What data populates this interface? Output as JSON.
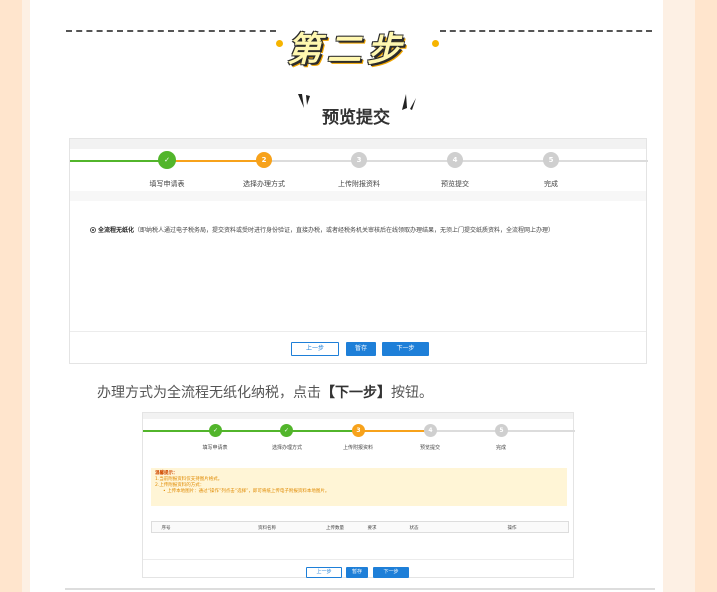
{
  "step_title": "第二步",
  "section_title": "预览提交",
  "screenshot1": {
    "steps": [
      {
        "num": "",
        "label": "填写申请表",
        "state": "done"
      },
      {
        "num": "2",
        "label": "选择办理方式",
        "state": "active"
      },
      {
        "num": "3",
        "label": "上传附报资料",
        "state": "todo"
      },
      {
        "num": "4",
        "label": "预览提交",
        "state": "todo"
      },
      {
        "num": "5",
        "label": "完成",
        "state": "todo"
      }
    ],
    "option_title": "全流程无纸化",
    "option_desc": "（即纳税人通过电子税务局，提交资料或受时进行身份验证，直接办税，或者经税务机关审核后在线领取办理结果，无须上门提交纸质资料，全流程网上办理）",
    "buttons": {
      "prev": "上一步",
      "save": "暂存",
      "next": "下一步"
    }
  },
  "caption_pre": "办理方式为全流程无纸化纳税，点击",
  "caption_bold": "【下一步】",
  "caption_post": "按钮。",
  "screenshot2": {
    "steps": [
      {
        "num": "",
        "label": "填写申请表",
        "state": "done"
      },
      {
        "num": "",
        "label": "选择办理方式",
        "state": "done"
      },
      {
        "num": "3",
        "label": "上传附报资料",
        "state": "active"
      },
      {
        "num": "4",
        "label": "预览提交",
        "state": "todo"
      },
      {
        "num": "5",
        "label": "完成",
        "state": "todo"
      }
    ],
    "notice_title": "温馨提示：",
    "notice_lines": [
      "1.当前附报资料仅支持图片格式。",
      "2.上传附报资料的方式：",
      "• 上传本地图片：通过“操作”列点击“选择”，即可将纸上传电子附报资料本地图片。"
    ],
    "table_headers": [
      "序号",
      "资料名称",
      "上传数量",
      "要求",
      "状态",
      "操作"
    ],
    "buttons": {
      "prev": "上一步",
      "save": "暂存",
      "next": "下一步"
    }
  },
  "colors": {
    "done": "#52b52b",
    "active": "#f7a21b",
    "todo": "#cfcfcf",
    "primary": "#1e7fd8"
  }
}
